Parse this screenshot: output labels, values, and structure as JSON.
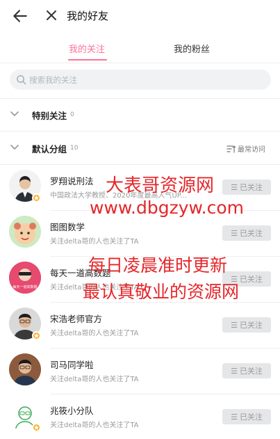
{
  "header": {
    "title": "我的好友"
  },
  "tabs": [
    {
      "label": "我的关注",
      "active": true
    },
    {
      "label": "我的粉丝",
      "active": false
    }
  ],
  "search": {
    "placeholder": "搜索我的关注"
  },
  "groups": [
    {
      "name": "特别关注",
      "count": "0",
      "expanded": false
    },
    {
      "name": "默认分组",
      "count": "10",
      "expanded": true,
      "sort_label": "最常访问"
    }
  ],
  "users": [
    {
      "name": "罗翔说刑法",
      "desc": "中国政法大学教授、2020年度最高人气UP...",
      "follow_label": "已关注",
      "verified": true
    },
    {
      "name": "图图数学",
      "desc": "关注delta哥的人也关注了TA",
      "follow_label": "已关注",
      "verified": false
    },
    {
      "name": "每天一道高数题",
      "desc": "关注delta哥的人也关注了TA",
      "follow_label": "已关注",
      "verified": false,
      "avatar_text": "每天一道高数题"
    },
    {
      "name": "宋浩老师官方",
      "desc": "关注delta哥的人也关注了TA",
      "follow_label": "已关注",
      "verified": true
    },
    {
      "name": "司马同学啦",
      "desc": "关注delta哥的人也关注了TA",
      "follow_label": "已关注",
      "verified": false
    },
    {
      "name": "兆筱小分队",
      "desc": "关注delta哥的人也关注了TA",
      "follow_label": "已关注",
      "verified": true
    }
  ],
  "watermark": {
    "line1": "大表哥资源网",
    "line2": "www.dbgzyw.com",
    "line3": "每日凌晨准时更新",
    "line4": "最认真敬业的资源网"
  },
  "colors": {
    "accent": "#fb7299",
    "badge": "#ffb027",
    "watermark": "#e5262a"
  }
}
